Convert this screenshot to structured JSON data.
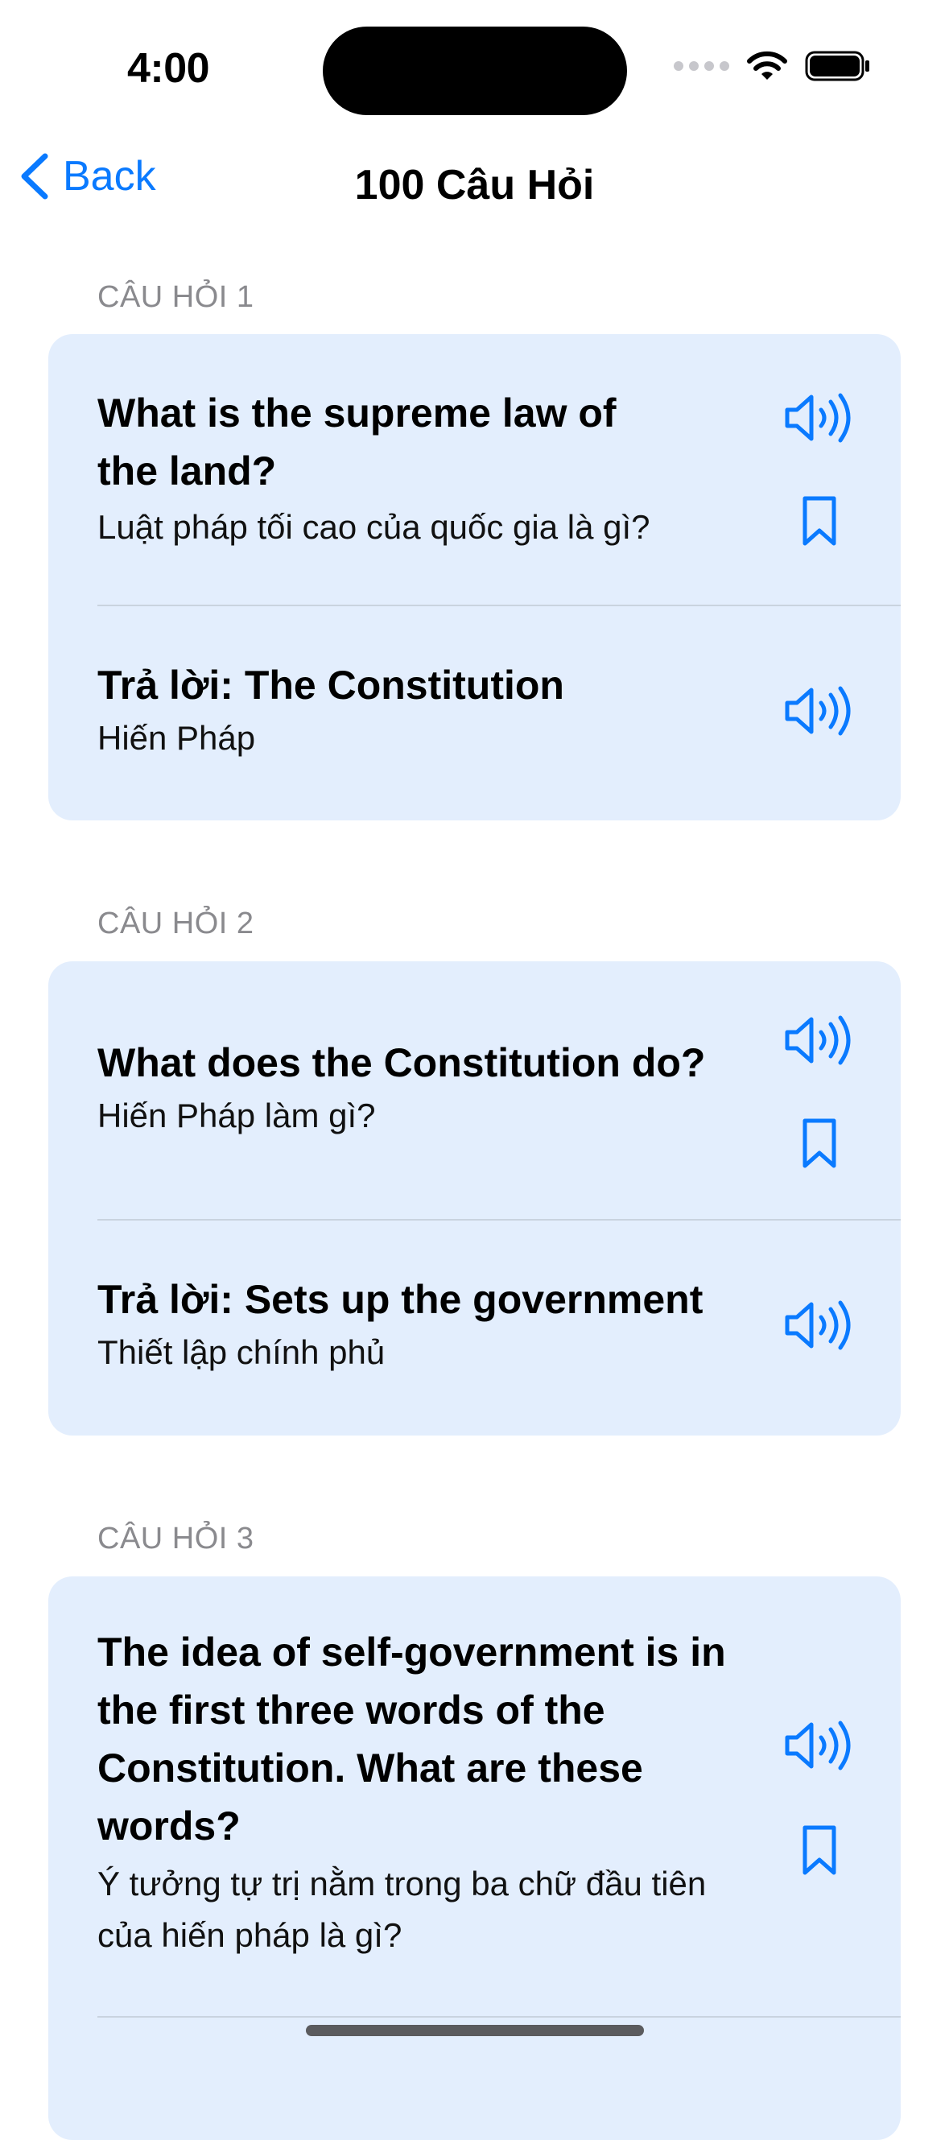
{
  "status_bar": {
    "time": "4:00"
  },
  "nav": {
    "back_label": "Back",
    "title": "100 Câu Hỏi"
  },
  "questions": [
    {
      "header": "CÂU HỎI 1",
      "question_en": "What is the supreme law of the land?",
      "question_vi": "Luật pháp tối cao của quốc gia là gì?",
      "answer_en": "Trả lời: The Constitution",
      "answer_vi": "Hiến Pháp"
    },
    {
      "header": "CÂU HỎI 2",
      "question_en": "What does the Constitution do?",
      "question_vi": "Hiến Pháp làm gì?",
      "answer_en": "Trả lời: Sets up the government",
      "answer_vi": "Thiết lập chính phủ"
    },
    {
      "header": "CÂU HỎI 3",
      "question_en": "The idea of self-government is in the first three words of the Constitution. What are these words?",
      "question_vi": "Ý tưởng tự trị nằm trong ba chữ đầu tiên của hiến pháp là gì?"
    }
  ],
  "icons": {
    "back": "chevron-left-icon",
    "speaker": "speaker-wave-icon",
    "bookmark": "bookmark-icon",
    "wifi": "wifi-icon",
    "battery": "battery-icon"
  },
  "colors": {
    "accent": "#0a7aff",
    "card_bg": "#e3eefd",
    "header_gray": "#8a8a8e"
  }
}
